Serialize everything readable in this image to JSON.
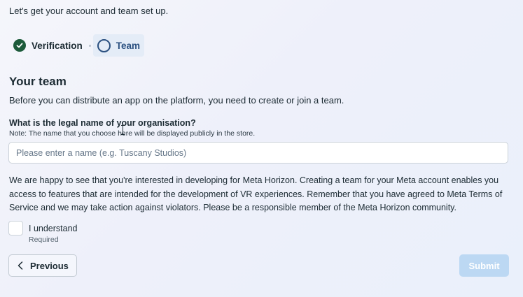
{
  "intro": "Let's get your account and team set up.",
  "stepper": {
    "steps": [
      {
        "label": "Verification",
        "state": "complete",
        "icon": "check-circle-icon"
      },
      {
        "label": "Team",
        "state": "current",
        "icon": "empty-circle-icon"
      }
    ]
  },
  "section": {
    "title": "Your team",
    "subtitle": "Before you can distribute an app on the platform, you need to create or join a team."
  },
  "name_field": {
    "label": "What is the legal name of your organisation?",
    "note": "Note: The name that you choose here will be displayed publicly in the store.",
    "placeholder": "Please enter a name (e.g. Tuscany Studios)",
    "value": ""
  },
  "terms_text": "We are happy to see that you're interested in developing for Meta Horizon. Creating a team for your Meta account enables you access to features that are intended for the development of VR experiences. Remember that you have agreed to Meta Terms of Service and we may take action against violators. Please be a responsible member of the Meta Horizon community.",
  "agreement": {
    "label": "I understand",
    "required_text": "Required",
    "checked": false
  },
  "actions": {
    "previous_label": "Previous",
    "submit_label": "Submit",
    "submit_enabled": false
  },
  "colors": {
    "check_complete": "#1c5a3a",
    "active_step": "#2b5080",
    "submit_disabled": "#bcd8f3"
  }
}
